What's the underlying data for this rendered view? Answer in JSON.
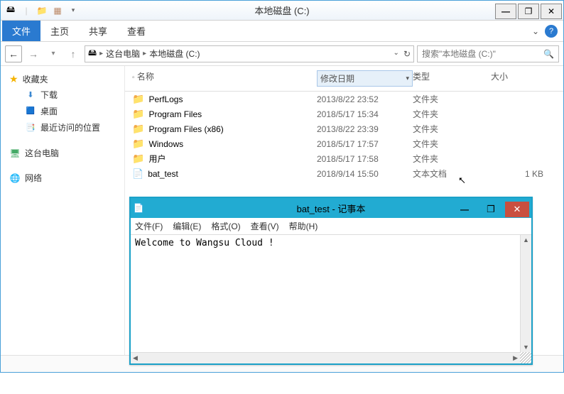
{
  "explorer": {
    "title": "本地磁盘 (C:)",
    "qat": {
      "new_folder": "📁",
      "props": "▦"
    },
    "ribbon": {
      "file": "文件",
      "home": "主页",
      "share": "共享",
      "view": "查看"
    },
    "breadcrumb": {
      "root_icon": "🖥",
      "items": [
        "这台电脑",
        "本地磁盘 (C:)"
      ]
    },
    "search": {
      "placeholder": "搜索\"本地磁盘 (C:)\""
    },
    "sidebar": {
      "favorites": {
        "label": "收藏夹",
        "items": [
          {
            "icon": "down",
            "label": "下载"
          },
          {
            "icon": "desk",
            "label": "桌面"
          },
          {
            "icon": "recent",
            "label": "最近访问的位置"
          }
        ]
      },
      "this_pc": {
        "label": "这台电脑"
      },
      "network": {
        "label": "网络"
      }
    },
    "columns": {
      "name": "名称",
      "date": "修改日期",
      "type": "类型",
      "size": "大小"
    },
    "files": [
      {
        "name": "PerfLogs",
        "date": "2013/8/22 23:52",
        "type": "文件夹",
        "size": "",
        "kind": "folder"
      },
      {
        "name": "Program Files",
        "date": "2018/5/17 15:34",
        "type": "文件夹",
        "size": "",
        "kind": "folder"
      },
      {
        "name": "Program Files (x86)",
        "date": "2013/8/22 23:39",
        "type": "文件夹",
        "size": "",
        "kind": "folder"
      },
      {
        "name": "Windows",
        "date": "2018/5/17 17:57",
        "type": "文件夹",
        "size": "",
        "kind": "folder"
      },
      {
        "name": "用户",
        "date": "2018/5/17 17:58",
        "type": "文件夹",
        "size": "",
        "kind": "folder"
      },
      {
        "name": "bat_test",
        "date": "2018/9/14 15:50",
        "type": "文本文档",
        "size": "1 KB",
        "kind": "file"
      }
    ]
  },
  "notepad": {
    "title": "bat_test - 记事本",
    "menu": {
      "file": "文件(F)",
      "edit": "编辑(E)",
      "format": "格式(O)",
      "view": "查看(V)",
      "help": "帮助(H)"
    },
    "content": "Welcome to Wangsu Cloud !"
  }
}
